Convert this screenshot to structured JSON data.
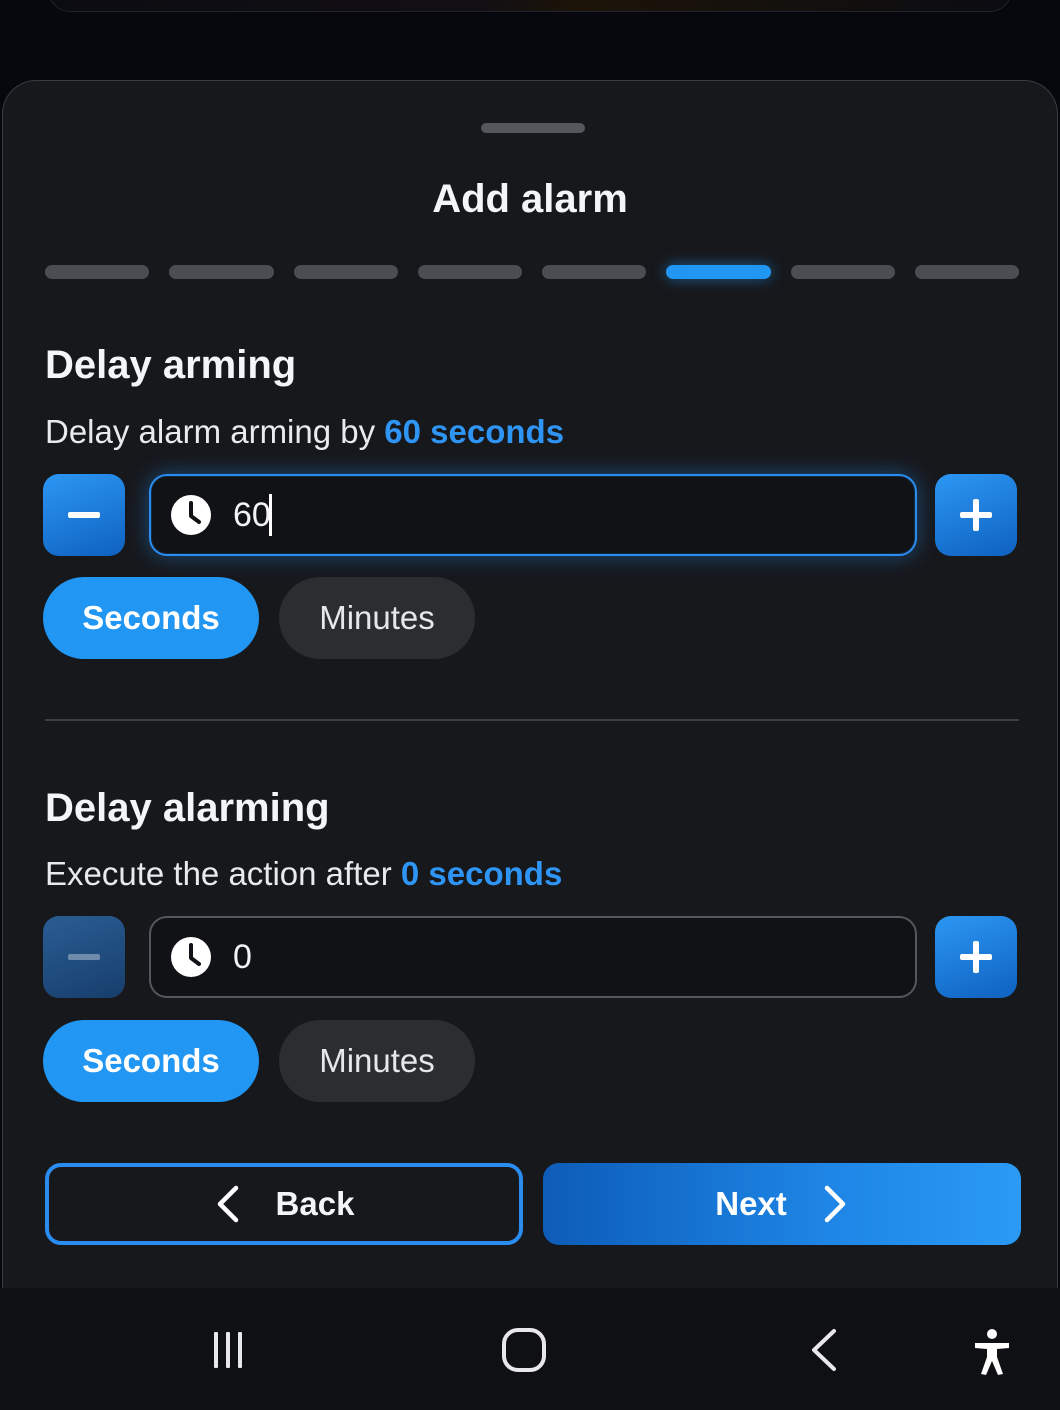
{
  "sheet": {
    "title": "Add alarm",
    "steps_total": 8,
    "active_step": 6
  },
  "delay_arming": {
    "title": "Delay arming",
    "desc_prefix": "Delay alarm arming by ",
    "desc_value": "60 seconds",
    "input_value": "60",
    "unit_options": [
      "Seconds",
      "Minutes"
    ],
    "selected_unit": "Seconds",
    "minus_icon": "minus-icon",
    "plus_icon": "plus-icon",
    "field_icon": "clock-icon"
  },
  "delay_alarming": {
    "title": "Delay alarming",
    "desc_prefix": "Execute the action after ",
    "desc_value": "0 seconds",
    "input_value": "0",
    "unit_options": [
      "Seconds",
      "Minutes"
    ],
    "selected_unit": "Seconds",
    "minus_icon": "minus-icon",
    "plus_icon": "plus-icon",
    "field_icon": "clock-icon"
  },
  "footer": {
    "back_label": "Back",
    "next_label": "Next",
    "back_icon": "chevron-left-icon",
    "next_icon": "chevron-right-icon"
  },
  "system_nav": {
    "items": [
      "recent-apps-icon",
      "home-icon",
      "back-icon",
      "accessibility-icon"
    ]
  },
  "colors": {
    "accent": "#2196f3",
    "sheet_bg": "#17181c",
    "page_bg": "#07080d"
  }
}
